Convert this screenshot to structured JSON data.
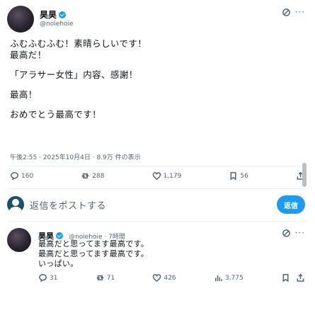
{
  "main_post": {
    "author_name": "昊昊",
    "handle": "@noiehoie",
    "text_lines": [
      "ふむふむふむ！素晴らしいです！",
      "最高だ！",
      "",
      "「アラサー女性」内容、感謝！",
      "",
      "最高！",
      "",
      "おめでとう最高です！"
    ],
    "timestamp": "午後2:55 · 2025年10月4日 · 8.9万 件の表示",
    "actions": {
      "reply_count": "160",
      "retweet_count": "288",
      "like_count": "1,179",
      "bookmark_count": "56"
    }
  },
  "reply_box": {
    "placeholder": "返信をポストする",
    "button_label": "返信"
  },
  "reply_post": {
    "author_name": "昊昊",
    "handle_time": "@noiehoie · 7時間",
    "text_lines": [
      "最高だと思ってます最高です。",
      "最高だと思ってます最高です。",
      "いっぱい。"
    ],
    "actions": {
      "reply_count": "31",
      "retweet_count": "71",
      "like_count": "426",
      "views_count": "3,775"
    }
  },
  "icons": {
    "more": "more-horizontal-icon",
    "reply": "comment-bubble-icon",
    "retweet": "retweet-arrows-icon",
    "like": "heart-icon",
    "bookmark": "bookmark-icon",
    "share": "share-upload-icon",
    "views": "bar-chart-icon",
    "grok": "grok-icon"
  },
  "colors": {
    "accent": "#1d9bf0",
    "text": "#0f1419",
    "secondary": "#536471"
  }
}
